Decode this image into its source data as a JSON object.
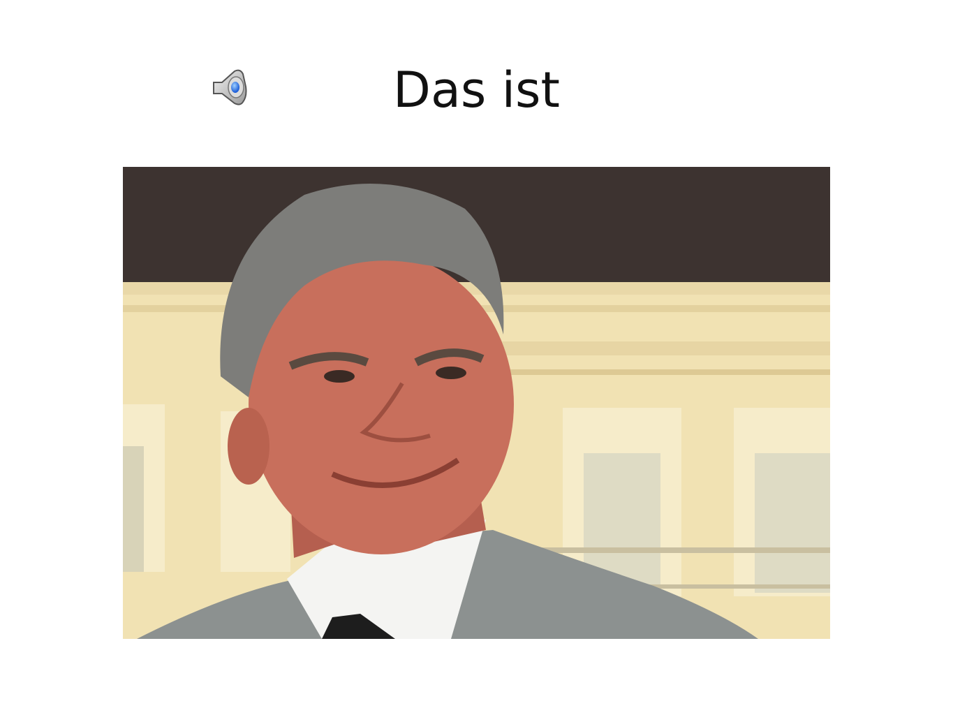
{
  "slide": {
    "title": "Das ist"
  },
  "audio": {
    "icon": "speaker-icon"
  },
  "photo": {
    "subject": "portrait-photo",
    "colors": {
      "wall": "#f1e2b3",
      "roof": "#3d3330",
      "skin": "#c86f5c",
      "hair": "#7d7d7a",
      "jacket": "#8c9190",
      "shirt": "#f4f4f2"
    }
  }
}
